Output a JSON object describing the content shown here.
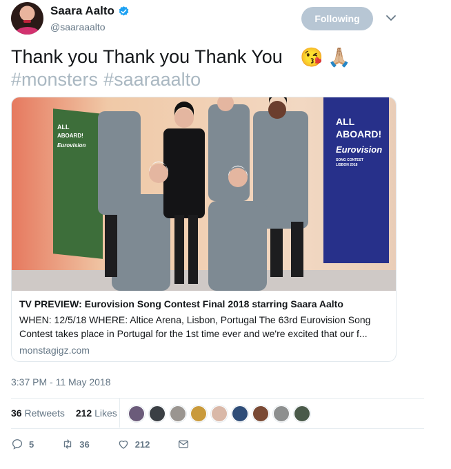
{
  "author": {
    "display_name": "Saara Aalto",
    "handle": "@saaraaalto",
    "verified_icon": "verified-badge-icon"
  },
  "follow_button": {
    "label": "Following"
  },
  "tweet": {
    "text": "Thank you Thank you Thank You",
    "emojis": [
      "😘",
      "🙏🏼"
    ],
    "hashtags": [
      "#monsters",
      "#saaraaalto"
    ]
  },
  "card": {
    "image_banners": {
      "left": [
        "ALL",
        "ABOARD!",
        "Eurovision"
      ],
      "right": [
        "ALL",
        "ABOARD!",
        "Eurovision",
        "SONG CONTEST",
        "LISBON 2018"
      ]
    },
    "title": "TV PREVIEW: Eurovision Song Contest Final 2018 starring Saara Aalto",
    "description": "WHEN: 12/5/18 WHERE: Altice Arena, Lisbon, Portugal The 63rd Eurovision Song Contest takes place in Portugal for the 1st time ever and we're excited that our f...",
    "domain": "monstagigz.com"
  },
  "timestamp": "3:37 PM - 11 May 2018",
  "stats": {
    "retweets_count": "36",
    "retweets_label": "Retweets",
    "likes_count": "212",
    "likes_label": "Likes"
  },
  "likers": [
    {
      "color": "#6b5b7a"
    },
    {
      "color": "#3a3f44"
    },
    {
      "color": "#9a9590"
    },
    {
      "color": "#c99a3c"
    },
    {
      "color": "#d9b8a8"
    },
    {
      "color": "#2f4d78"
    },
    {
      "color": "#7a4a35"
    },
    {
      "color": "#8d8f8f"
    },
    {
      "color": "#4a5a4a"
    }
  ],
  "actions": {
    "reply_count": "5",
    "retweet_count": "36",
    "like_count": "212"
  },
  "colors": {
    "accent": "#1da1f2",
    "follow_bg": "#b7c6d4",
    "muted": "#657786",
    "hashtag": "#aab8c2"
  }
}
